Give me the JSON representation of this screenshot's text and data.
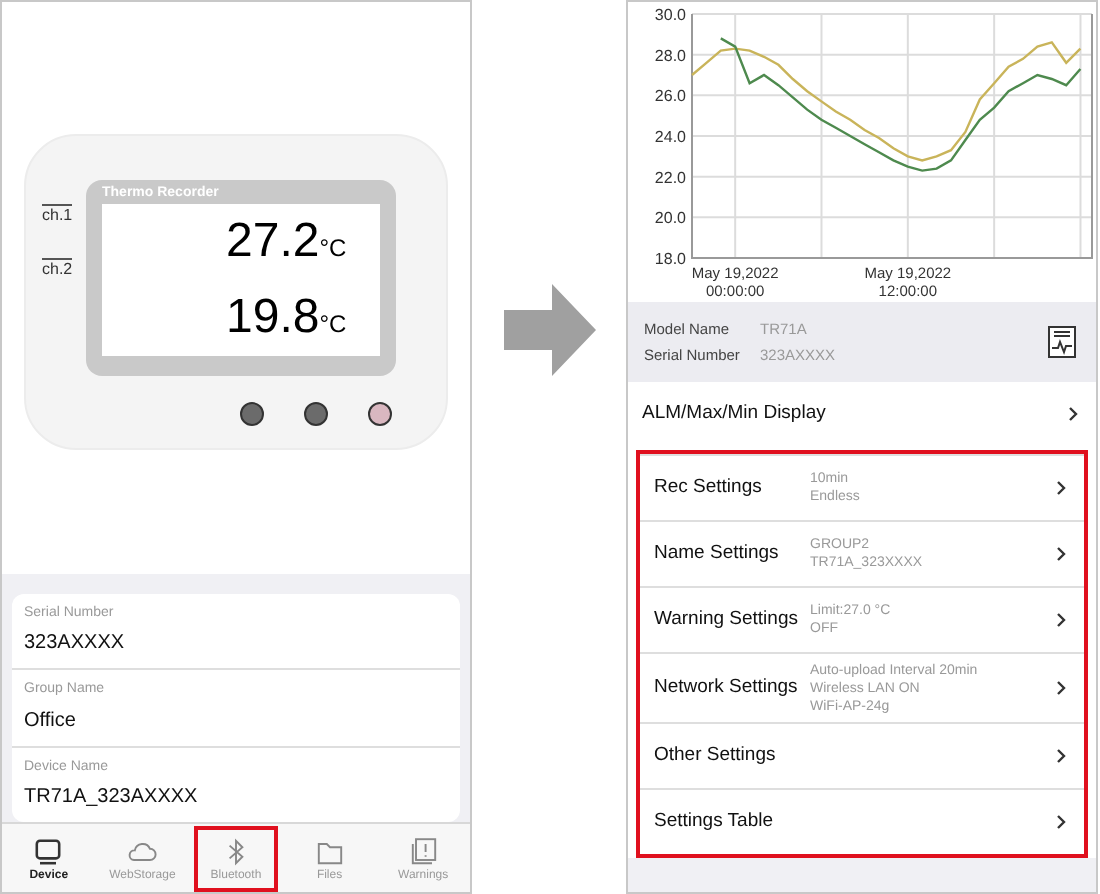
{
  "device": {
    "title": "Thermo Recorder",
    "channels": [
      {
        "label": "ch.1",
        "value": "27.2",
        "unit": "°C"
      },
      {
        "label": "ch.2",
        "value": "19.8",
        "unit": "°C"
      }
    ],
    "buttons": [
      {
        "color": "#6b6b6b"
      },
      {
        "color": "#6b6b6b"
      },
      {
        "color": "#d9b7c0"
      }
    ]
  },
  "info_fields": [
    {
      "label": "Serial Number",
      "value": "323AXXXX"
    },
    {
      "label": "Group Name",
      "value": "Office"
    },
    {
      "label": "Device Name",
      "value": "TR71A_323AXXXX"
    }
  ],
  "tabs": [
    {
      "label": "Device",
      "selected": true,
      "highlighted": false,
      "kind": "device"
    },
    {
      "label": "WebStorage",
      "selected": false,
      "highlighted": false,
      "kind": "cloud"
    },
    {
      "label": "Bluetooth",
      "selected": false,
      "highlighted": true,
      "kind": "bluetooth"
    },
    {
      "label": "Files",
      "selected": false,
      "highlighted": false,
      "kind": "folder"
    },
    {
      "label": "Warnings",
      "selected": false,
      "highlighted": false,
      "kind": "warning"
    }
  ],
  "chart_data": {
    "type": "line",
    "grid": true,
    "categories": [
      null,
      null,
      null,
      "May 19,2022 00:00:00",
      null,
      null,
      null,
      null,
      null,
      null,
      null,
      null,
      null,
      null,
      null,
      "May 19,2022 12:00:00",
      null,
      null,
      null,
      null,
      null,
      null,
      null,
      null,
      null,
      null,
      null,
      null
    ],
    "series": [
      {
        "color": "#c9b45a",
        "values": [
          27.0,
          27.6,
          28.2,
          28.3,
          28.2,
          27.9,
          27.5,
          26.8,
          26.2,
          25.7,
          25.2,
          24.8,
          24.3,
          23.9,
          23.4,
          23.0,
          22.8,
          23.0,
          23.3,
          24.2,
          25.8,
          26.6,
          27.4,
          27.8,
          28.4,
          28.6,
          27.6,
          28.3
        ]
      },
      {
        "color": "#4e8a4e",
        "values": [
          null,
          null,
          28.8,
          28.4,
          26.6,
          27.0,
          26.5,
          25.9,
          25.3,
          24.8,
          24.4,
          24.0,
          23.6,
          23.2,
          22.8,
          22.5,
          22.3,
          22.4,
          22.8,
          23.8,
          24.8,
          25.4,
          26.2,
          26.6,
          27.0,
          26.8,
          26.5,
          27.3
        ]
      }
    ],
    "ylim": [
      18,
      30
    ],
    "yticks": [
      {
        "value": 18,
        "label": "18.0"
      },
      {
        "value": 20,
        "label": "20.0"
      },
      {
        "value": 22,
        "label": "22.0"
      },
      {
        "value": 24,
        "label": "24.0"
      },
      {
        "value": 26,
        "label": "26.0"
      },
      {
        "value": 28,
        "label": "28.0"
      },
      {
        "value": 30,
        "label": "30.0"
      }
    ]
  },
  "model": {
    "rows": [
      {
        "label": "Model Name",
        "value": "TR71A"
      },
      {
        "label": "Serial Number",
        "value": "323AXXXX"
      }
    ]
  },
  "menu": [
    {
      "title": "ALM/Max/Min Display",
      "highlighted": false
    },
    {
      "title": "Rec Settings",
      "details": [
        "10min",
        "Endless"
      ],
      "highlighted": true
    },
    {
      "title": "Name Settings",
      "details": [
        "GROUP2",
        "TR71A_323XXXX"
      ],
      "highlighted": true
    },
    {
      "title": "Warning Settings",
      "details": [
        "Limit:27.0 °C",
        "OFF"
      ],
      "highlighted": true
    },
    {
      "title": "Network Settings",
      "details": [
        "Auto-upload Interval 20min",
        "Wireless LAN ON",
        "WiFi-AP-24g"
      ],
      "highlighted": true
    },
    {
      "title": "Other Settings",
      "highlighted": true
    },
    {
      "title": "Settings Table",
      "highlighted": true
    }
  ]
}
